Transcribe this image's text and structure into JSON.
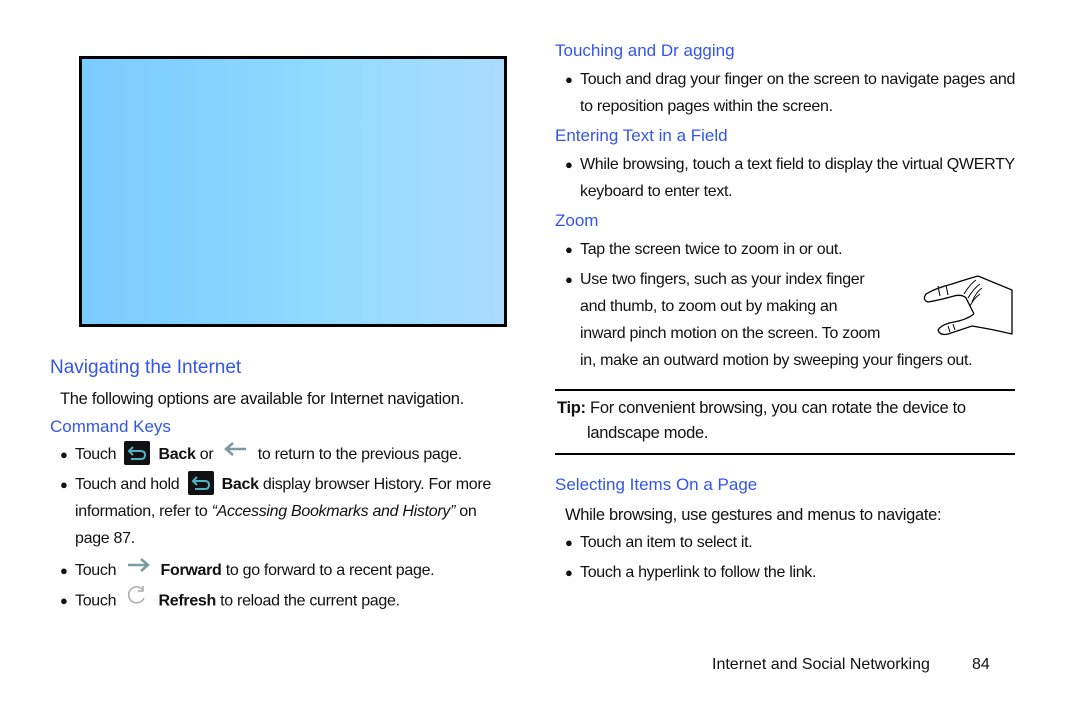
{
  "left": {
    "section_title": "Navigating the Internet",
    "intro": "The following options are available for Internet navigation.",
    "subsection_title": "Command Keys",
    "bullets": [
      {
        "pre": "Touch",
        "icon1": "back-key-icon",
        "bold": "Back",
        "mid": "or",
        "icon2": "back-arrow-icon",
        "post": "to return to the previous page."
      },
      {
        "pre": "Touch and hold",
        "icon1": "back-key-icon",
        "bold": "Back",
        "line1_post": "display browser History. For more",
        "line2_pre": "information, refer to",
        "line2_ref": "“Accessing Bookmarks and History”",
        "line2_post": "on",
        "line3": "page 87."
      },
      {
        "pre": "Touch",
        "icon1": "forward-arrow-icon",
        "bold": "Forward",
        "post": "to go forward to a recent page."
      },
      {
        "pre": "Touch",
        "icon1": "refresh-icon",
        "bold": "Refresh",
        "post": "to reload the current page."
      }
    ]
  },
  "right": {
    "touching": {
      "title": "Touching    and Dr  agging",
      "line1": "Touch and drag your finger on the screen to navigate pages and",
      "line2": "to reposition pages within the screen."
    },
    "entering": {
      "title": "Entering Text in a Field",
      "line1": "While browsing, touch a text field to display the virtual QWERTY",
      "line2": "keyboard to enter text."
    },
    "zoom": {
      "title": "Zoom",
      "bullet1": "Tap the screen twice to zoom in or out.",
      "bullet2_line1": "Use two fingers, such as your index finger",
      "bullet2_line2": "and thumb, to zoom out by making an",
      "bullet2_line3": "inward pinch motion on the screen. To zoom",
      "bullet2_line4": "in, make an outward motion by sweeping your fingers out.",
      "illustration": "pinch-hand-icon"
    },
    "tip": {
      "label": "Tip:",
      "line1": "For convenient browsing, you can rotate the device to",
      "line2": "landscape mode."
    },
    "selecting": {
      "title": "Selecting Items On a Page",
      "intro": "While browsing, use gestures and menus to navigate:",
      "bullet1": "Touch an item to select it.",
      "bullet2": "Touch a hyperlink to follow the link."
    }
  },
  "footer": {
    "chapter": "Internet and Social Networking",
    "page_number": "84"
  },
  "colors": {
    "heading": "#3355ee",
    "text": "#111111",
    "screenshot_gradient_start": "#7acbff",
    "screenshot_gradient_end": "#aadcff",
    "icon_teal": "#4fb3c8"
  }
}
